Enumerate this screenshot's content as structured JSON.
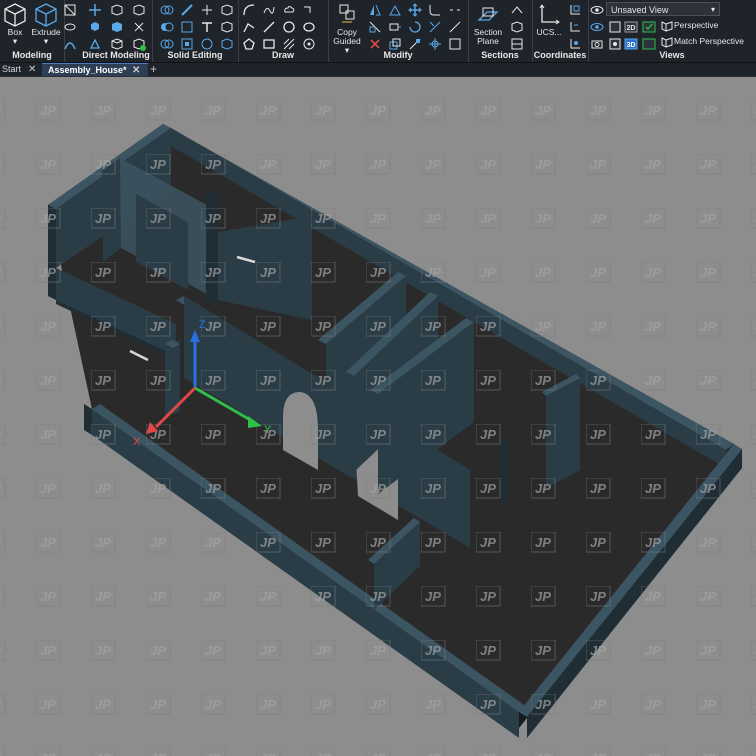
{
  "ribbon": {
    "modeling": {
      "title": "Modeling",
      "box_label": "Box",
      "extrude_label": "Extrude"
    },
    "direct_modeling": {
      "title": "Direct Modeling"
    },
    "solid_editing": {
      "title": "Solid Editing"
    },
    "draw": {
      "title": "Draw"
    },
    "modify": {
      "title": "Modify",
      "copy_label": "Copy",
      "guided_label": "Guided"
    },
    "sections": {
      "title": "Sections",
      "section_label": "Section",
      "plane_label": "Plane"
    },
    "coordinates": {
      "title": "Coordinates",
      "ucs_label": "UCS..."
    },
    "views": {
      "title": "Views",
      "view_select": "Unsaved View",
      "perspective_label": "Perspective",
      "match_perspective_label": "Match Perspective",
      "twod_label": "2D",
      "threed_label": "3D"
    }
  },
  "tabs": [
    {
      "label": "Start"
    },
    {
      "label": "Assembly_House*"
    }
  ],
  "new_tab": "+",
  "close_glyph": "✕",
  "viewport": {
    "watermark_text": "JP",
    "axis_labels": {
      "z": "Z",
      "y": "Y",
      "x": "X"
    },
    "colors": {
      "background": "#8d8d8d",
      "wall_top": "#3c5562",
      "wall_side": "#2a3d47",
      "wall_dark": "#1f2d35",
      "floor": "#2a2a2a",
      "axis_x": "#e04848",
      "axis_y": "#2fc04a",
      "axis_z": "#2a6fe0"
    }
  }
}
